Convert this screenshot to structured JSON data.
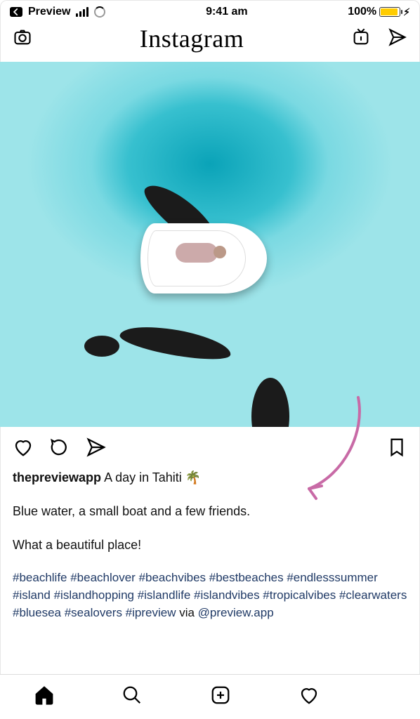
{
  "status": {
    "back_label": "Preview",
    "time": "9:41 am",
    "battery_percent": "100%"
  },
  "header": {
    "logo_text": "Instagram"
  },
  "post": {
    "username": "thepreviewapp",
    "caption_lead": "A day in Tahiti",
    "caption_emoji": "🌴",
    "line1": "Blue water, a small boat and a few friends.",
    "line2": "What a beautiful place!",
    "hashtags": "#beachlife #beachlover #beachvibes #bestbeaches #endlesssummer #island #islandhopping #islandlife #islandvibes #tropicalvibes #clearwaters #bluesea #sealovers #ipreview",
    "via_text": " via ",
    "mention": "@preview.app"
  },
  "icons": {
    "camera": "camera-icon",
    "igtv": "igtv-icon",
    "send": "send-icon",
    "like": "heart-icon",
    "comment": "comment-icon",
    "share": "send-icon",
    "bookmark": "bookmark-icon",
    "home": "home-icon",
    "search": "search-icon",
    "add": "add-post-icon",
    "activity": "heart-icon",
    "profile": "preview-badge-icon"
  }
}
